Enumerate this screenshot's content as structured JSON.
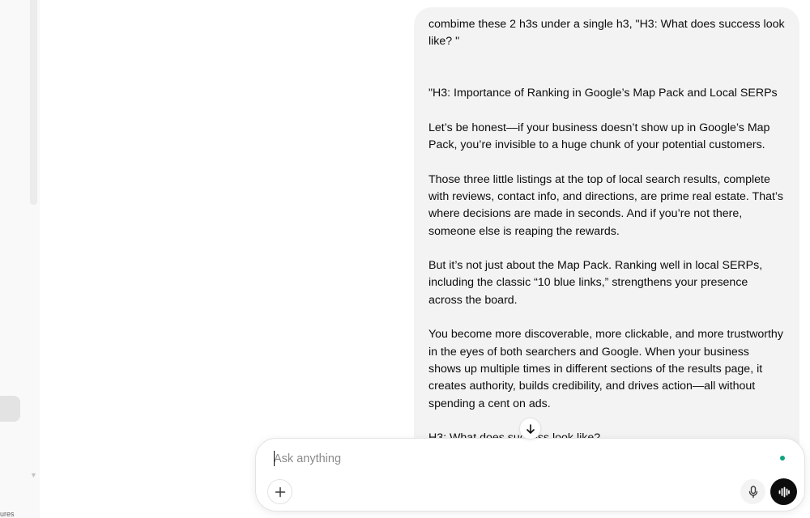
{
  "sidebar": {
    "clipped_label": "ures"
  },
  "message": {
    "lines": [
      "combime these 2 h3s under a single h3, \"H3: What does success look like? \"",
      "\"H3: Importance of Ranking in Google’s Map Pack and Local SERPs",
      "Let’s be honest—if your business doesn’t show up in Google’s Map Pack, you’re invisible to a huge chunk of your potential customers.",
      "Those three little listings at the top of local search results, complete with reviews, contact info, and directions, are prime real estate. That’s where decisions are made in seconds. And if you’re not there, someone else is reaping the rewards.",
      "But it’s not just about the Map Pack. Ranking well in local SERPs, including the classic “10 blue links,” strengthens your presence across the board.",
      "You become more discoverable, more clickable, and more trustworthy in the eyes of both searchers and Google. When your business shows up multiple times in different sections of the results page, it creates authority, builds credibility, and drives action—all without spending a cent on ads.",
      "H3: What does success look like?"
    ]
  },
  "composer": {
    "placeholder": "Ask anything"
  },
  "icons": {
    "scroll_down": "arrow-down-icon",
    "plus": "plus-icon",
    "mic": "microphone-icon",
    "voice": "voice-waveform-icon"
  },
  "colors": {
    "bubble": "#f3f3f3",
    "status_dot": "#10a37f",
    "voice_button": "#0d0d0d"
  }
}
